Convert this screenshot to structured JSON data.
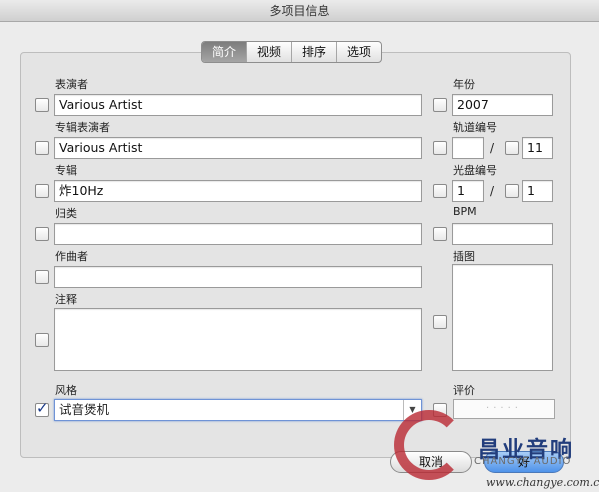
{
  "window": {
    "title": "多项目信息"
  },
  "tabs": [
    {
      "label": "简介",
      "active": true
    },
    {
      "label": "视频",
      "active": false
    },
    {
      "label": "排序",
      "active": false
    },
    {
      "label": "选项",
      "active": false
    }
  ],
  "fields": {
    "artist": {
      "label": "表演者",
      "value": "Various Artist",
      "checked": false
    },
    "album_artist": {
      "label": "专辑表演者",
      "value": "Various Artist",
      "checked": false
    },
    "album": {
      "label": "专辑",
      "value": "炸10Hz",
      "checked": false
    },
    "grouping": {
      "label": "归类",
      "value": "",
      "checked": false
    },
    "composer": {
      "label": "作曲者",
      "value": "",
      "checked": false
    },
    "comments": {
      "label": "注释",
      "value": "",
      "checked": false
    },
    "genre": {
      "label": "风格",
      "value": "试音煲机",
      "checked": true
    },
    "year": {
      "label": "年份",
      "value": "2007",
      "checked": false
    },
    "track_number": {
      "label": "轨道编号",
      "value": "",
      "of": "11",
      "separator": "/"
    },
    "disc_number": {
      "label": "光盘编号",
      "value": "1",
      "of": "1",
      "separator": "/"
    },
    "bpm": {
      "label": "BPM",
      "value": ""
    },
    "artwork": {
      "label": "插图"
    },
    "rating": {
      "label": "评价",
      "stars": "·····"
    }
  },
  "buttons": {
    "cancel": "取消",
    "ok": "好"
  },
  "watermark": {
    "brand_cn": "昌业音响",
    "brand_en": "CHANGYE AUDIO",
    "url": "www.changye.com.cn"
  },
  "colors": {
    "default_button": "#4f93ea",
    "focus_ring": "#6f93d6",
    "watermark_red": "#b92832",
    "watermark_blue": "#223d7c"
  }
}
